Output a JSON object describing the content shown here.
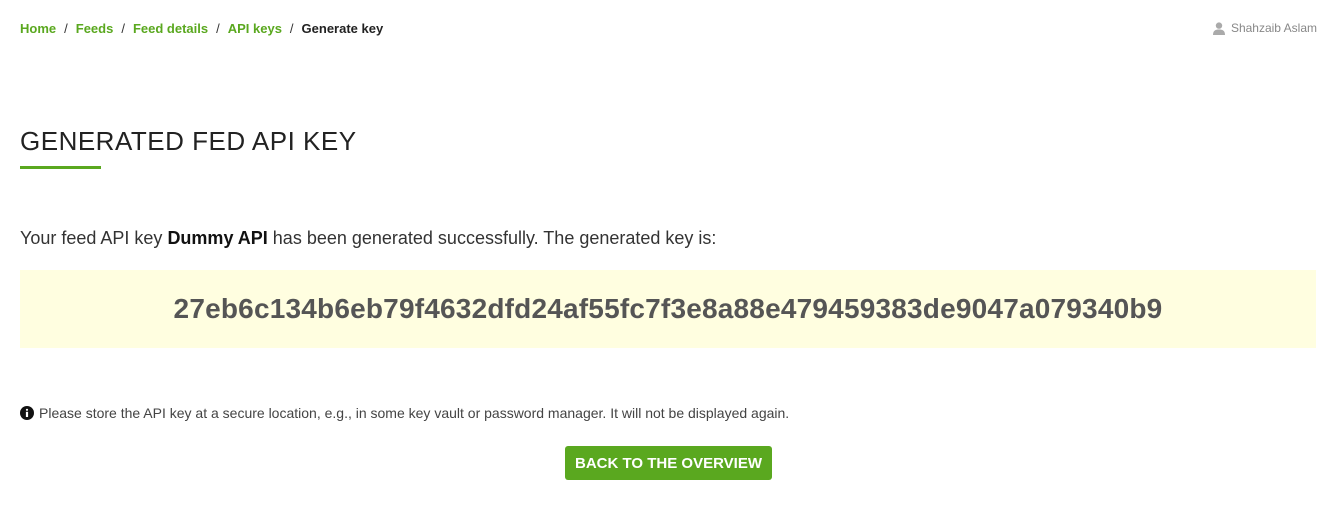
{
  "breadcrumb": {
    "items": [
      {
        "label": "Home"
      },
      {
        "label": "Feeds"
      },
      {
        "label": "Feed details"
      },
      {
        "label": "API keys"
      }
    ],
    "current": "Generate key",
    "separator": "/"
  },
  "user": {
    "name": "Shahzaib Aslam",
    "icon": "user-icon"
  },
  "page": {
    "title": "GENERATED FED API KEY"
  },
  "message": {
    "prefix": "Your feed API key ",
    "key_name": "Dummy API",
    "suffix": " has been generated successfully. The generated key is:"
  },
  "api_key": "27eb6c134b6eb79f4632dfd24af55fc7f3e8a88e479459383de9047a079340b9",
  "notice": {
    "icon": "info-icon",
    "text": "Please store the API key at a secure location, e.g., in some key vault or password manager. It will not be displayed again."
  },
  "actions": {
    "back_label": "BACK TO THE OVERVIEW"
  },
  "colors": {
    "accent": "#5aa81f",
    "key_background": "#fffee0"
  }
}
